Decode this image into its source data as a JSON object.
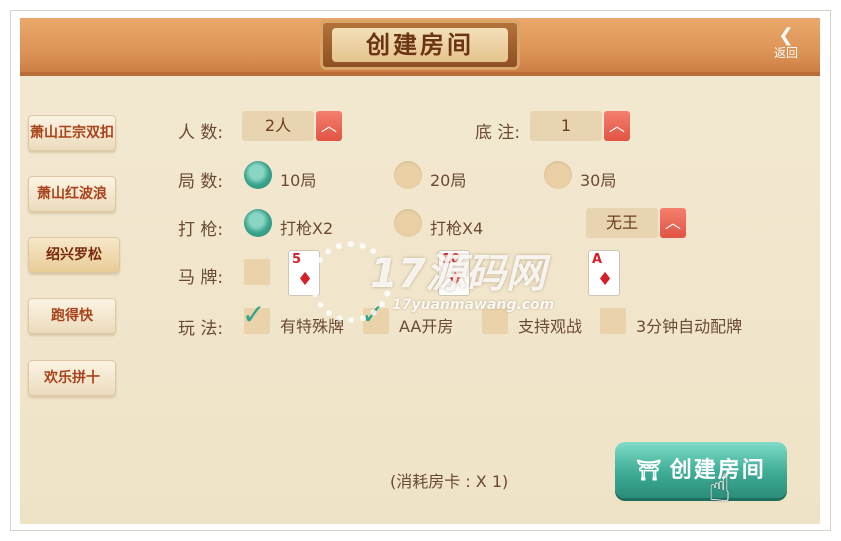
{
  "header": {
    "title": "创建房间",
    "back_label": "返回",
    "back_icon": "back-arrow-icon"
  },
  "sidebar": {
    "items": [
      {
        "label": "萧山正宗双扣",
        "active": false
      },
      {
        "label": "萧山红波浪",
        "active": false
      },
      {
        "label": "绍兴罗松",
        "active": true
      },
      {
        "label": "跑得快",
        "active": false
      },
      {
        "label": "欢乐拼十",
        "active": false
      }
    ]
  },
  "settings": {
    "players": {
      "label": "人  数:",
      "value": "2人"
    },
    "base_bet": {
      "label": "底  注:",
      "value": "1"
    },
    "rounds": {
      "label": "局  数:",
      "options": [
        "10局",
        "20局",
        "30局"
      ],
      "selected": "10局"
    },
    "gun": {
      "label": "打  枪:",
      "options": [
        "打枪X2",
        "打枪X4"
      ],
      "selected": "打枪X2",
      "joker_value": "无王"
    },
    "horse": {
      "label": "马  牌:",
      "cards": [
        {
          "rank": "5",
          "suit": "♦"
        },
        {
          "rank": "10",
          "suit": "♦"
        },
        {
          "rank": "A",
          "suit": "♦"
        }
      ]
    },
    "rules": {
      "label": "玩  法:",
      "options": [
        {
          "text": "有特殊牌",
          "checked": true
        },
        {
          "text": "AA开房",
          "checked": true
        },
        {
          "text": "支持观战",
          "checked": false
        },
        {
          "text": "3分钟自动配牌",
          "checked": false
        }
      ]
    }
  },
  "footer": {
    "cost": "(消耗房卡 : X 1)",
    "create_label": "创建房间"
  },
  "watermark": {
    "main": "17源码网",
    "sub": "17yuanmawang.com"
  },
  "colors": {
    "accent_green": "#3eac95",
    "header_brown": "#dd9356",
    "up_red": "#e05443"
  }
}
